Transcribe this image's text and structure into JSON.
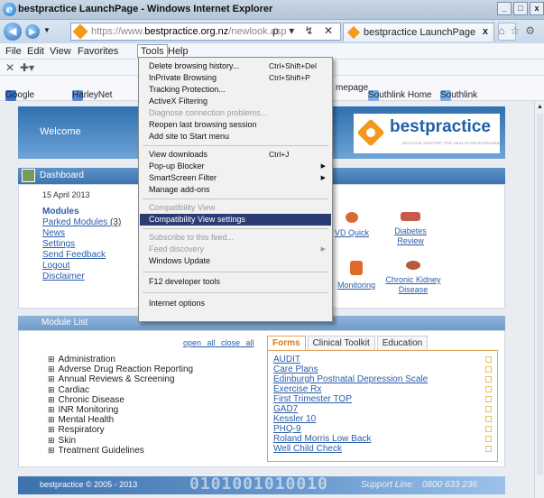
{
  "window": {
    "title": "bestpractice LaunchPage - Windows Internet Explorer",
    "buttons": [
      "_",
      "□",
      "x"
    ]
  },
  "address": {
    "url_prefix": "https://www.",
    "url_domain": "bestpractice.org.nz",
    "url_path": "/newlook.asp",
    "controls": "ρ ▾ ↯ ✕"
  },
  "tab": {
    "label": "bestpractice LaunchPage",
    "close": "x"
  },
  "menubar": {
    "file": "File",
    "edit": "Edit",
    "view": "View",
    "favorites": "Favorites",
    "tools": "Tools",
    "help": "Help"
  },
  "favorites_bar": {
    "items": [
      "Google",
      "HarleyNet",
      "mepage",
      "Southlink Home",
      "Southlink"
    ]
  },
  "tools_menu": {
    "items": [
      {
        "label": "Delete browsing history...",
        "shortcut": "Ctrl+Shift+Del"
      },
      {
        "label": "InPrivate Browsing",
        "shortcut": "Ctrl+Shift+P"
      },
      {
        "label": "Tracking Protection..."
      },
      {
        "label": "ActiveX Filtering"
      },
      {
        "label": "Diagnose connection problems..."
      },
      {
        "label": "Reopen last browsing session"
      },
      {
        "label": "Add site to Start menu"
      },
      {
        "label": "View downloads",
        "shortcut": "Ctrl+J"
      },
      {
        "label": "Pop-up Blocker"
      },
      {
        "label": "SmartScreen Filter"
      },
      {
        "label": "Manage add-ons"
      },
      {
        "label": "Compatibility View"
      },
      {
        "label": "Compatibility View settings"
      },
      {
        "label": "Subscribe to this feed..."
      },
      {
        "label": "Feed discovery"
      },
      {
        "label": "Windows Update"
      },
      {
        "label": "F12 developer tools"
      },
      {
        "label": "Internet options"
      }
    ]
  },
  "page": {
    "welcome": "Welcome",
    "logo_word": "bestpractice",
    "logo_tag": "DECISION SUPPORT FOR HEALTH PROFESSIONALS",
    "dashboard_title": "Dashboard",
    "date": "15 April 2013",
    "nav": {
      "modules": "Modules",
      "parked": "Parked Modules",
      "parked_count": "(3)",
      "news": "News",
      "settings": "Settings",
      "feedback": "Send Feedback",
      "logout": "Logout",
      "disclaimer": "Disclaimer"
    },
    "tiles": {
      "cvd": "VD Quick",
      "diabetes_1": "Diabetes",
      "diabetes_2": "Review",
      "monitoring": "Monitoring",
      "ckd_1": "Chronic Kidney",
      "ckd_2": "Disease"
    },
    "module_list_title": "Module List",
    "open_all": "open all",
    "close_all": "close all",
    "modules": [
      "Administration",
      "Adverse Drug Reaction Reporting",
      "Annual Reviews & Screening",
      "Cardiac",
      "Chronic Disease",
      "INR Monitoring",
      "Mental Health",
      "Respiratory",
      "Skin",
      "Treatment Guidelines"
    ],
    "panel_tabs": [
      "Forms",
      "Clinical Toolkit",
      "Education"
    ],
    "forms": [
      "AUDIT",
      "Care Plans",
      "Edinburgh Postnatal Depression Scale",
      "Exercise Rx",
      "First Trimester TOP",
      "GAD7",
      "Kessler 10",
      "PHQ-9",
      "Roland Morris Low Back",
      "Well Child Check"
    ],
    "footer_copy": "bestpractice © 2005 - 2013",
    "footer_bits": "0101001010010",
    "support_label": "Support Line:",
    "support_number": "0800 633 236"
  },
  "colors": {
    "menu_highlight": "#2d3b73",
    "brand_blue": "#1f5fa8",
    "brand_orange": "#f39a1d"
  }
}
